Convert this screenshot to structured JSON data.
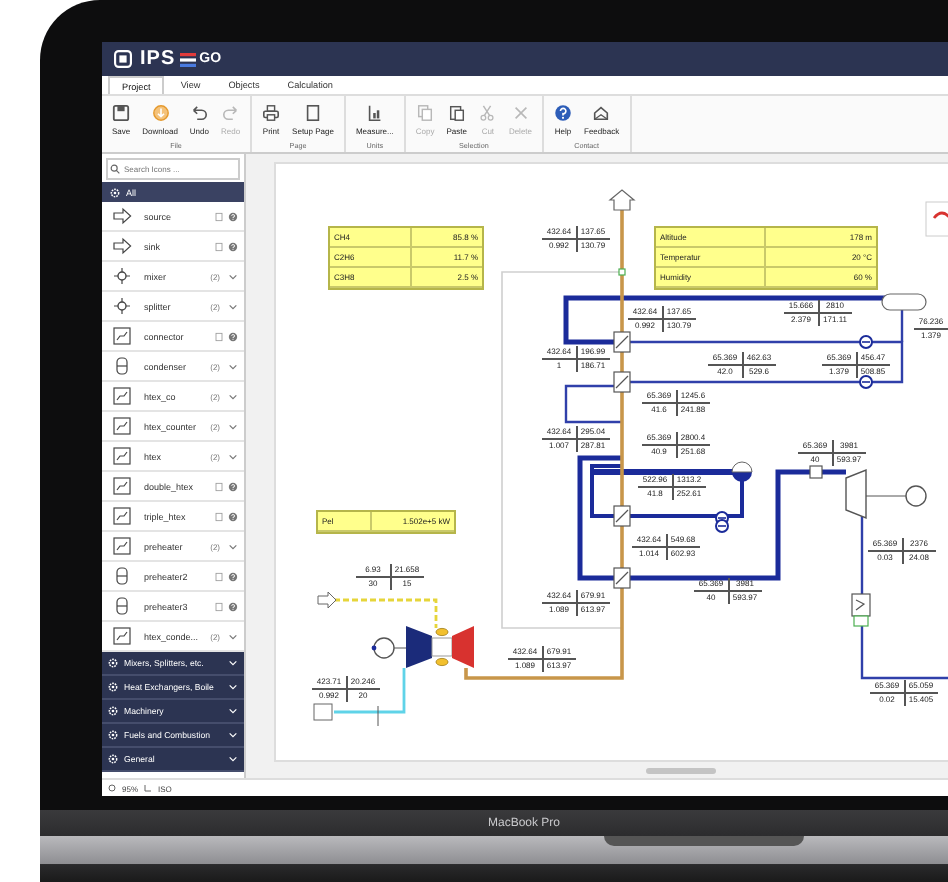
{
  "app": {
    "logo_left": "IPS",
    "logo_right": "GO"
  },
  "menu_tabs": [
    {
      "label": "Project",
      "selected": true
    },
    {
      "label": "View",
      "selected": false
    },
    {
      "label": "Objects",
      "selected": false
    },
    {
      "label": "Calculation",
      "selected": false
    }
  ],
  "ribbon": [
    {
      "label": "File",
      "buttons": [
        {
          "label": "Save",
          "disabled": false
        },
        {
          "label": "Download",
          "disabled": false
        },
        {
          "label": "Undo",
          "disabled": false
        },
        {
          "label": "Redo",
          "disabled": true
        }
      ]
    },
    {
      "label": "Page",
      "buttons": [
        {
          "label": "Print",
          "disabled": false
        },
        {
          "label": "Setup Page",
          "disabled": false
        }
      ]
    },
    {
      "label": "Units",
      "buttons": [
        {
          "label": "Measure...",
          "disabled": false
        }
      ]
    },
    {
      "label": "Selection",
      "buttons": [
        {
          "label": "Copy",
          "disabled": true
        },
        {
          "label": "Paste",
          "disabled": false
        },
        {
          "label": "Cut",
          "disabled": true
        },
        {
          "label": "Delete",
          "disabled": true
        }
      ]
    },
    {
      "label": "Contact",
      "buttons": [
        {
          "label": "Help",
          "disabled": false
        },
        {
          "label": "Feedback",
          "disabled": false
        }
      ]
    }
  ],
  "sidebar": {
    "search": {
      "placeholder": "Search Icons ..."
    },
    "all_label": "All",
    "items": [
      {
        "label": "source",
        "kind": "single"
      },
      {
        "label": "sink",
        "kind": "single"
      },
      {
        "label": "mixer",
        "kind": "group",
        "count": "(2)"
      },
      {
        "label": "splitter",
        "kind": "group",
        "count": "(2)"
      },
      {
        "label": "connector",
        "kind": "single"
      },
      {
        "label": "condenser",
        "kind": "group",
        "count": "(2)"
      },
      {
        "label": "htex_co",
        "kind": "group",
        "count": "(2)"
      },
      {
        "label": "htex_counter",
        "kind": "group",
        "count": "(2)"
      },
      {
        "label": "htex",
        "kind": "group",
        "count": "(2)"
      },
      {
        "label": "double_htex",
        "kind": "single"
      },
      {
        "label": "triple_htex",
        "kind": "single"
      },
      {
        "label": "preheater",
        "kind": "group",
        "count": "(2)"
      },
      {
        "label": "preheater2",
        "kind": "single"
      },
      {
        "label": "preheater3",
        "kind": "single"
      },
      {
        "label": "htex_conde...",
        "kind": "group",
        "count": "(2)"
      }
    ],
    "categories": [
      {
        "label": "Mixers, Splitters, etc."
      },
      {
        "label": "Heat Exchangers, Boile"
      },
      {
        "label": "Machinery"
      },
      {
        "label": "Fuels and Combustion"
      },
      {
        "label": "General"
      }
    ]
  },
  "canvas": {
    "property_tables": [
      {
        "rows": [
          {
            "label": "CH4",
            "value": "85.8 %"
          },
          {
            "label": "C2H6",
            "value": "11.7 %"
          },
          {
            "label": "C3H8",
            "value": "2.5 %"
          }
        ]
      },
      {
        "rows": [
          {
            "label": "Altitude",
            "value": "178 m"
          },
          {
            "label": "Temperatur",
            "value": "20 °C"
          },
          {
            "label": "Humidity",
            "value": "60 %"
          }
        ]
      },
      {
        "rows": [
          {
            "label": "Pel",
            "value": "1.502e+5 kW"
          }
        ]
      }
    ],
    "streams": [
      {
        "values": [
          "432.64",
          "137.65",
          "0.992",
          "130.79"
        ]
      },
      {
        "values": [
          "432.64",
          "196.99",
          "1",
          "186.71"
        ]
      },
      {
        "values": [
          "432.64",
          "295.04",
          "1.007",
          "287.81"
        ]
      },
      {
        "values": [
          "432.64",
          "137.65",
          "0.992",
          "130.79"
        ]
      },
      {
        "values": [
          "15.666",
          "2810",
          "2.379",
          "171.11"
        ]
      },
      {
        "values": [
          "76.236",
          "1.379"
        ]
      },
      {
        "values": [
          "65.369",
          "462.63",
          "42.0",
          "529.6"
        ]
      },
      {
        "values": [
          "65.369",
          "456.47",
          "1.379",
          "508.85"
        ]
      },
      {
        "values": [
          "65.369",
          "1245.6",
          "41.6",
          "241.88"
        ]
      },
      {
        "values": [
          "65.369",
          "2800.4",
          "40.9",
          "251.68"
        ]
      },
      {
        "values": [
          "522.96",
          "1313.2",
          "41.8",
          "252.61"
        ]
      },
      {
        "values": [
          "65.369",
          "3981",
          "40",
          "593.97"
        ]
      },
      {
        "values": [
          "432.64",
          "549.68",
          "1.014",
          "602.93"
        ]
      },
      {
        "values": [
          "65.369",
          "3981",
          "40",
          "593.97"
        ]
      },
      {
        "values": [
          "432.64",
          "679.91",
          "1.089",
          "613.97"
        ]
      },
      {
        "values": [
          "432.64",
          "679.91",
          "1.089",
          "613.97"
        ]
      },
      {
        "values": [
          "6.93",
          "21.658",
          "30",
          "15"
        ]
      },
      {
        "values": [
          "423.71",
          "20.246",
          "0.992",
          "20"
        ]
      },
      {
        "values": [
          "65.369",
          "2376",
          "0.03",
          "24.08"
        ]
      },
      {
        "values": [
          "65.369",
          "65.059",
          "0.02",
          "15.405"
        ]
      }
    ]
  },
  "status_bar": {
    "zoom": "95%",
    "standard": "ISO"
  },
  "device_label": "MacBook Pro"
}
